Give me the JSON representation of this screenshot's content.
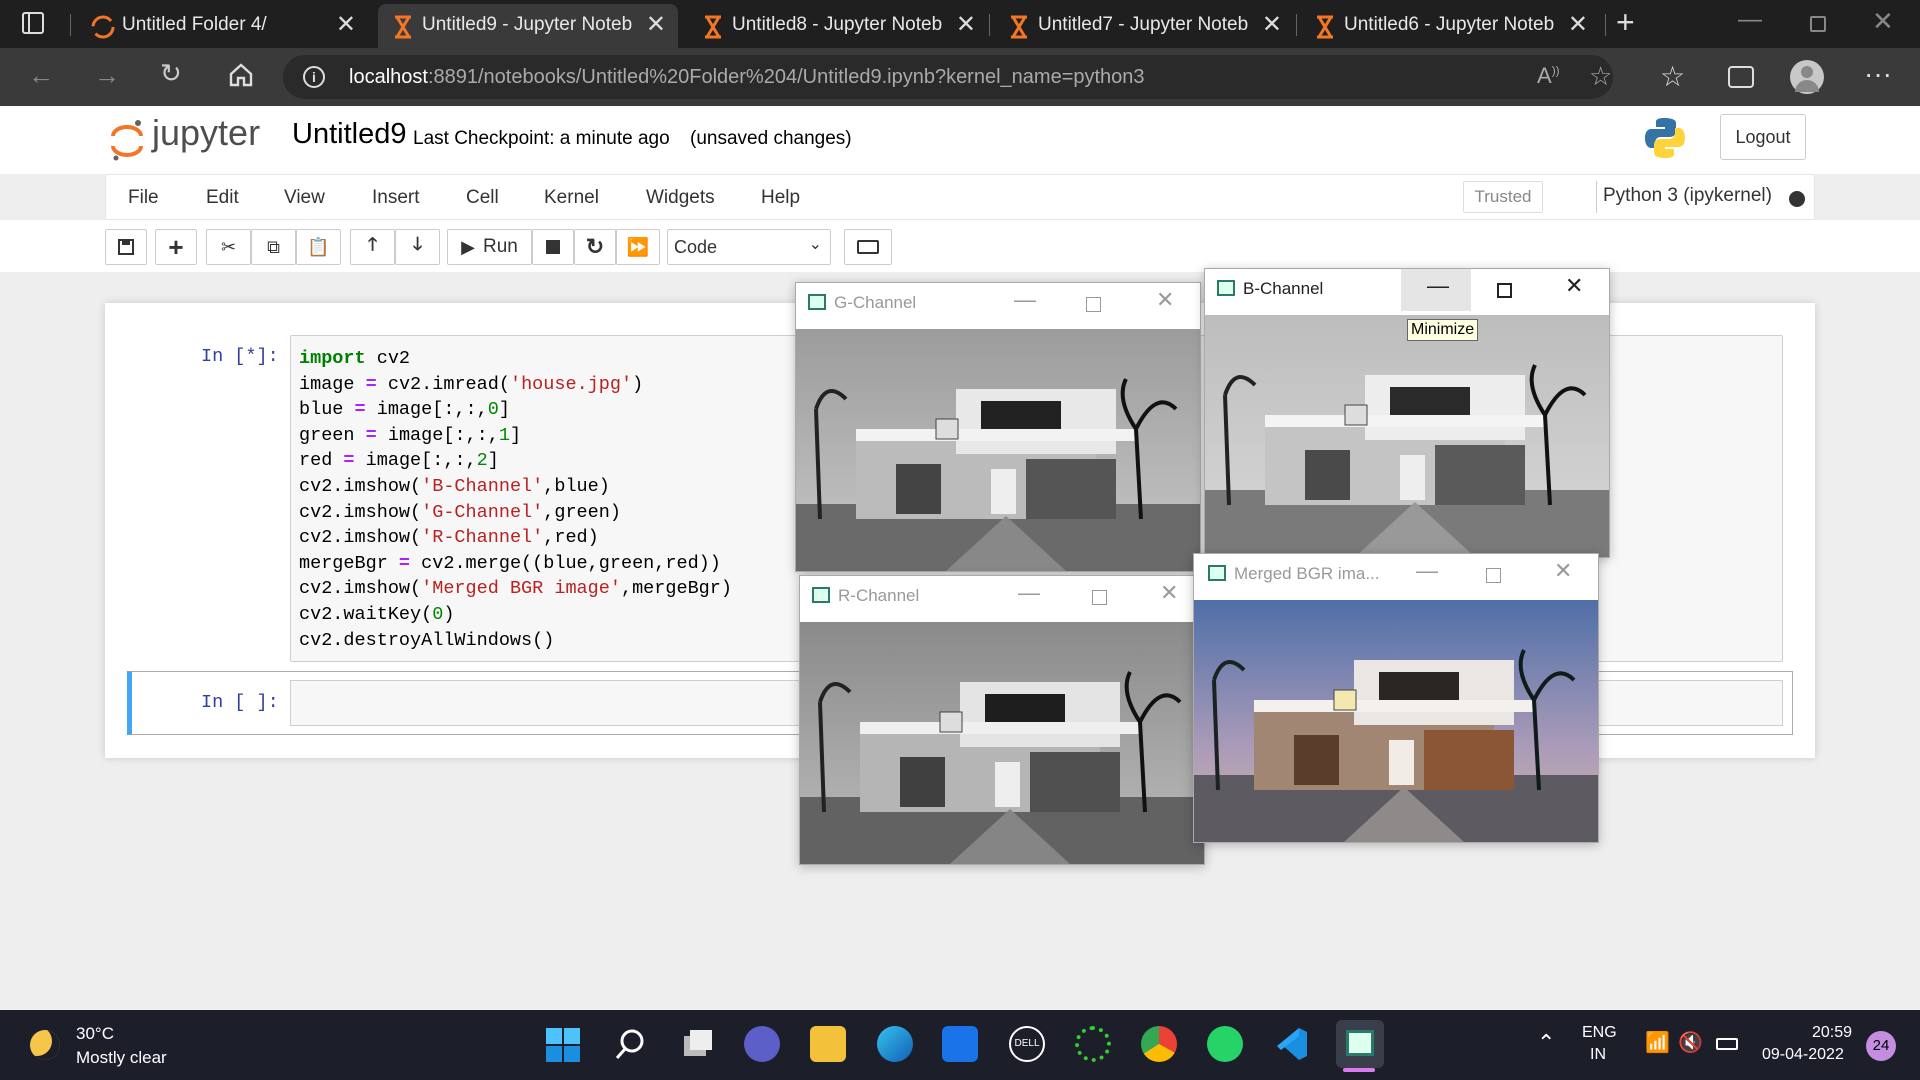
{
  "browser": {
    "tabs": [
      {
        "title": "Untitled Folder 4/",
        "active": false
      },
      {
        "title": "Untitled9 - Jupyter Notebo",
        "active": true
      },
      {
        "title": "Untitled8 - Jupyter Notebo",
        "active": false
      },
      {
        "title": "Untitled7 - Jupyter Notebo",
        "active": false
      },
      {
        "title": "Untitled6 - Jupyter Notebo",
        "active": false
      }
    ],
    "url_host": "localhost",
    "url_rest": ":8891/notebooks/Untitled%20Folder%204/Untitled9.ipynb?kernel_name=python3"
  },
  "jupyter": {
    "logo_text": "jupyter",
    "notebook_name": "Untitled9",
    "checkpoint": "Last Checkpoint: a minute ago",
    "unsaved": "(unsaved changes)",
    "logout": "Logout",
    "menu": [
      "File",
      "Edit",
      "View",
      "Insert",
      "Cell",
      "Kernel",
      "Widgets",
      "Help"
    ],
    "trusted": "Trusted",
    "kernel": "Python 3 (ipykernel)",
    "run_label": "Run",
    "cell_type": "Code"
  },
  "cells": [
    {
      "prompt": "In [*]:"
    },
    {
      "prompt": "In [ ]:"
    }
  ],
  "windows": {
    "g": "G-Channel",
    "b": "B-Channel",
    "r": "R-Channel",
    "m": "Merged BGR ima...",
    "tooltip": "Minimize"
  },
  "taskbar": {
    "temp": "30°C",
    "weather": "Mostly clear",
    "lang1": "ENG",
    "lang2": "IN",
    "time": "20:59",
    "date": "09-04-2022",
    "badge": "24"
  }
}
